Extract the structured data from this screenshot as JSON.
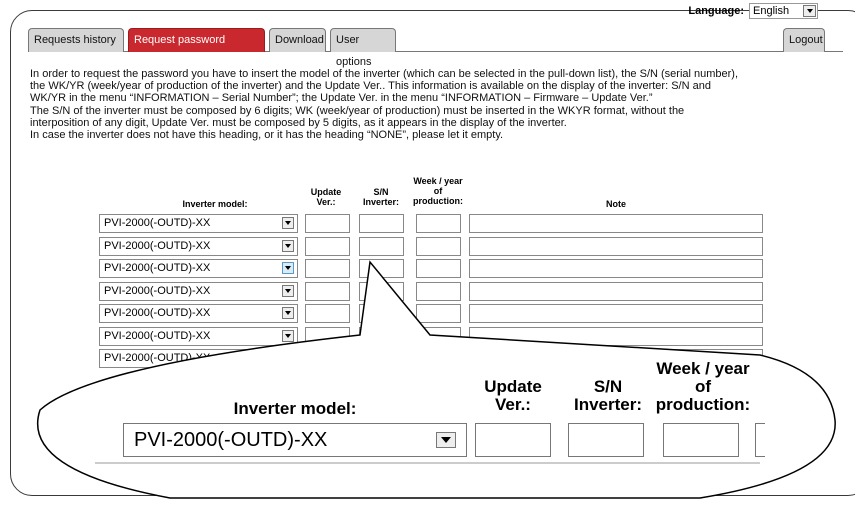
{
  "header": {
    "language_label": "Language:",
    "language_value": "English"
  },
  "tabs": [
    {
      "label": "Requests history"
    },
    {
      "label": "Request password Inverter"
    },
    {
      "label": "Download"
    },
    {
      "label": "User options"
    }
  ],
  "logout_label": "Logout",
  "intro": [
    "In order to request the password you have to insert the model of the inverter (which can be selected in the pull-down list), the S/N (serial number),",
    "the WK/YR (week/year of production of the inverter) and the Update Ver.. This information is available on the display of the inverter: S/N and",
    "WK/YR in the menu “INFORMATION – Serial Number”; the Update Ver. in the menu “INFORMATION – Firmware – Update Ver.”",
    "The S/N of the inverter must be composed by 6 digits; WK (week/year of production) must be inserted in the WKYR format, without the",
    "interposition of any digit, Update Ver. must be composed by 5 digits, as it appears in the display of the inverter.",
    "In case the inverter does not have this heading, or it has the heading “NONE”, please let it empty."
  ],
  "table": {
    "headers": {
      "model": "Inverter model:",
      "update": "Update Ver.:",
      "sn": "S/N Inverter:",
      "week": "Week / year of production:",
      "note": "Note"
    },
    "rows": [
      {
        "model": "PVI-2000(-OUTD)-XX"
      },
      {
        "model": "PVI-2000(-OUTD)-XX"
      },
      {
        "model": "PVI-2000(-OUTD)-XX"
      },
      {
        "model": "PVI-2000(-OUTD)-XX"
      },
      {
        "model": "PVI-2000(-OUTD)-XX"
      },
      {
        "model": "PVI-2000(-OUTD)-XX"
      },
      {
        "model": "PVI-2000(-OUTD)-XX"
      }
    ]
  },
  "zoom": {
    "headers": {
      "model": "Inverter model:",
      "update_l1": "Update",
      "update_l2": "Ver.:",
      "sn_l1": "S/N",
      "sn_l2": "Inverter:",
      "week_l1": "Week / year",
      "week_l2": "of",
      "week_l3": "production:"
    },
    "model_value": "PVI-2000(-OUTD)-XX"
  },
  "colors": {
    "active_tab": "#c9282e",
    "tab": "#d6d6d6"
  }
}
